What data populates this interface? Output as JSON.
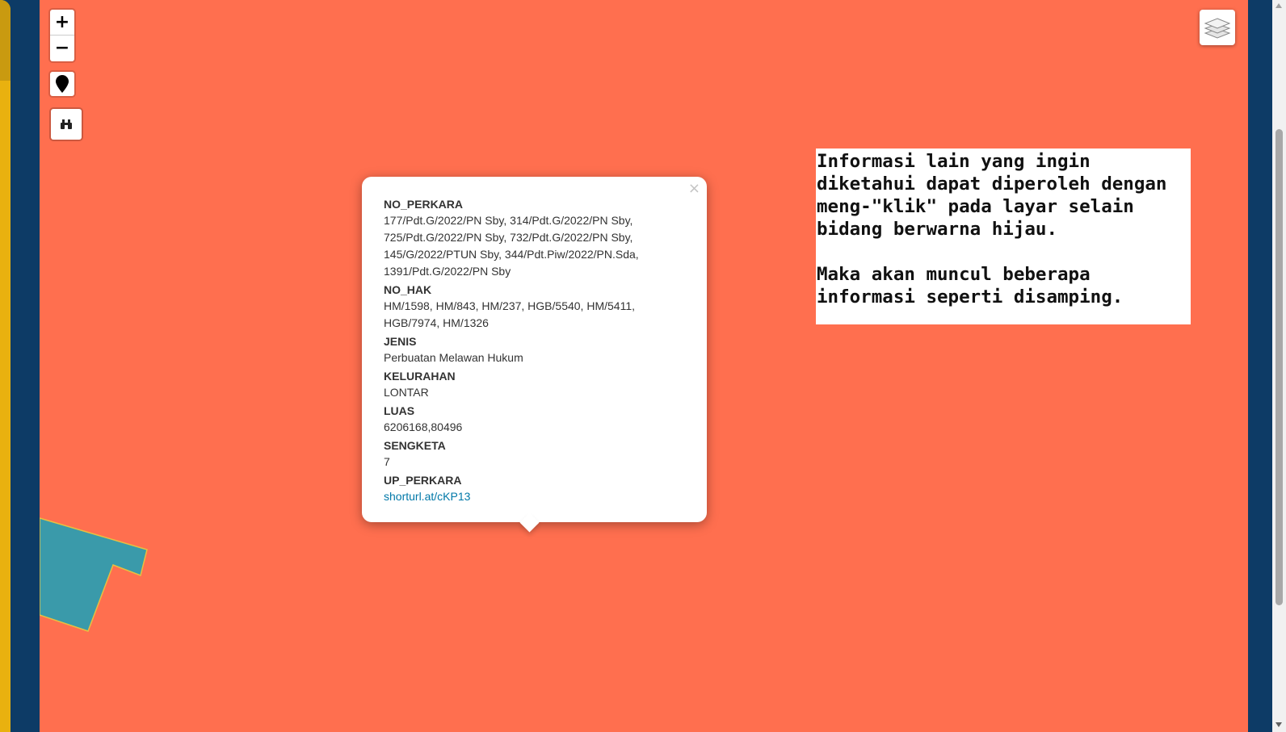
{
  "map": {
    "background_color": "#ff6f4f",
    "parcel_color": "#3a9aaa",
    "parcel_outline_color": "#e8c040"
  },
  "controls": {
    "zoom_in_label": "+",
    "zoom_out_label": "−",
    "locate_icon": "map-marker-icon",
    "search_icon": "binoculars-icon",
    "layers_icon": "layers-icon"
  },
  "popup": {
    "close_label": "×",
    "fields": [
      {
        "name": "NO_PERKARA",
        "value": "177/Pdt.G/2022/PN Sby, 314/Pdt.G/2022/PN Sby, 725/Pdt.G/2022/PN Sby, 732/Pdt.G/2022/PN Sby, 145/G/2022/PTUN Sby, 344/Pdt.Piw/2022/PN.Sda, 1391/Pdt.G/2022/PN Sby"
      },
      {
        "name": "NO_HAK",
        "value": "HM/1598, HM/843, HM/237, HGB/5540, HM/5411, HGB/7974, HM/1326"
      },
      {
        "name": "JENIS",
        "value": "Perbuatan Melawan Hukum"
      },
      {
        "name": "KELURAHAN",
        "value": "LONTAR"
      },
      {
        "name": "LUAS",
        "value": "6206168,80496"
      },
      {
        "name": "SENGKETA",
        "value": "7"
      },
      {
        "name": "UP_PERKARA",
        "value": "shorturl.at/cKP13"
      }
    ]
  },
  "info_box": {
    "text": "Informasi lain yang ingin\ndiketahui dapat diperoleh dengan\nmeng-\"klik\" pada layar selain\nbidang berwarna hijau.\n\nMaka akan muncul beberapa\ninformasi seperti disamping."
  }
}
